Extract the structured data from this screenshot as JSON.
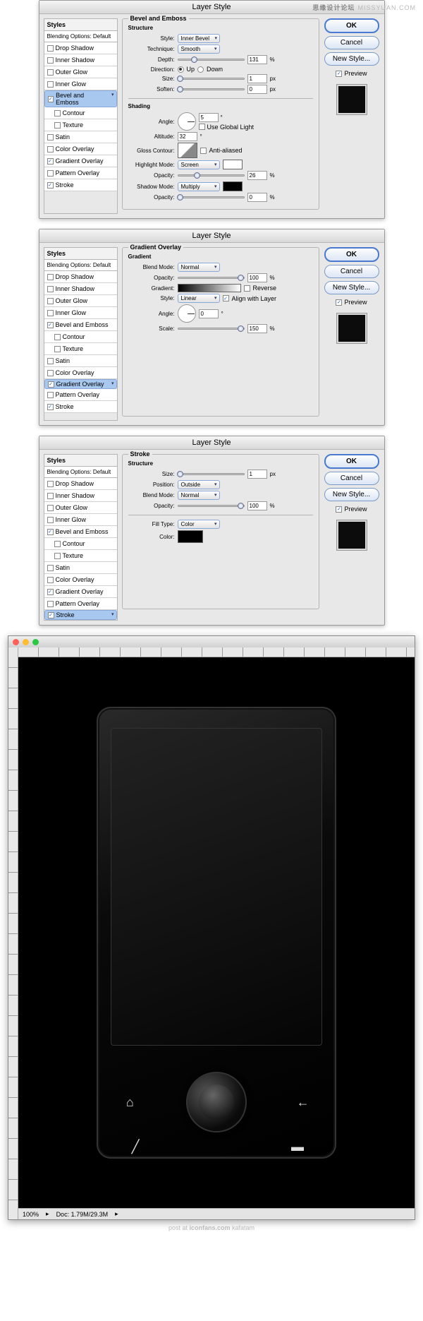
{
  "watermark": {
    "a": "思缘设计论坛",
    "b": "MISSYUAN.COM"
  },
  "common": {
    "title": "Layer Style",
    "styles_head": "Styles",
    "blending_opts": "Blending Options: Default",
    "ok": "OK",
    "cancel": "Cancel",
    "new_style": "New Style...",
    "preview": "Preview"
  },
  "effects": {
    "drop_shadow": "Drop Shadow",
    "inner_shadow": "Inner Shadow",
    "outer_glow": "Outer Glow",
    "inner_glow": "Inner Glow",
    "bevel_emboss": "Bevel and Emboss",
    "contour": "Contour",
    "texture": "Texture",
    "satin": "Satin",
    "color_overlay": "Color Overlay",
    "gradient_overlay": "Gradient Overlay",
    "pattern_overlay": "Pattern Overlay",
    "stroke": "Stroke"
  },
  "d1": {
    "group": "Bevel and Emboss",
    "structure": "Structure",
    "style_lbl": "Style:",
    "style_val": "Inner Bevel",
    "technique_lbl": "Technique:",
    "technique_val": "Smooth",
    "depth_lbl": "Depth:",
    "depth_val": "131",
    "pct": "%",
    "direction_lbl": "Direction:",
    "up": "Up",
    "down": "Down",
    "size_lbl": "Size:",
    "size_val": "1",
    "px": "px",
    "soften_lbl": "Soften:",
    "soften_val": "0",
    "shading": "Shading",
    "angle_lbl": "Angle:",
    "angle_val": "5",
    "global_light": "Use Global Light",
    "altitude_lbl": "Altitude:",
    "altitude_val": "32",
    "gloss_lbl": "Gloss Contour:",
    "antialias": "Anti-aliased",
    "hmode_lbl": "Highlight Mode:",
    "hmode_val": "Screen",
    "opacity_lbl": "Opacity:",
    "hopacity_val": "26",
    "smode_lbl": "Shadow Mode:",
    "smode_val": "Multiply",
    "sopacity_val": "0"
  },
  "d2": {
    "group": "Gradient Overlay",
    "gradient_head": "Gradient",
    "blend_lbl": "Blend Mode:",
    "blend_val": "Normal",
    "opacity_lbl": "Opacity:",
    "opacity_val": "100",
    "pct": "%",
    "gradient_lbl": "Gradient:",
    "reverse": "Reverse",
    "style_lbl": "Style:",
    "style_val": "Linear",
    "align": "Align with Layer",
    "angle_lbl": "Angle:",
    "angle_val": "0",
    "scale_lbl": "Scale:",
    "scale_val": "150"
  },
  "d3": {
    "group": "Stroke",
    "structure": "Structure",
    "size_lbl": "Size:",
    "size_val": "1",
    "px": "px",
    "position_lbl": "Position:",
    "position_val": "Outside",
    "blend_lbl": "Blend Mode:",
    "blend_val": "Normal",
    "opacity_lbl": "Opacity:",
    "opacity_val": "100",
    "pct": "%",
    "fill_lbl": "Fill Type:",
    "fill_val": "Color",
    "color_lbl": "Color:"
  },
  "ps": {
    "zoom": "100%",
    "doc": "Doc: 1.79M/29.3M"
  },
  "credit": {
    "a": "post at",
    "b": "iconfans.com",
    "c": "kafatam"
  }
}
